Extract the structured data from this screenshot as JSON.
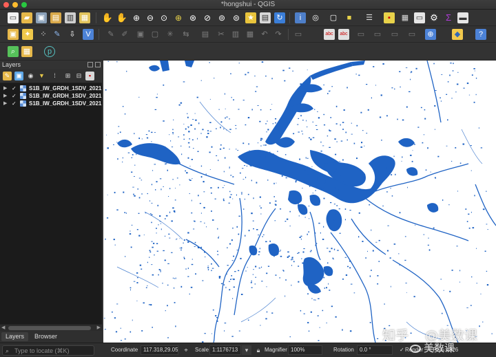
{
  "window": {
    "title": "*hongshui - QGIS"
  },
  "toolbars": {
    "row1": [
      "new-project-icon",
      "open-project-icon",
      "save-project-icon",
      "save-as-icon",
      "print-layout-icon",
      "layout-manager-icon",
      "pan-icon",
      "pan-to-selection-icon",
      "zoom-in-icon",
      "zoom-out-icon",
      "zoom-full-icon",
      "zoom-to-selection-icon",
      "zoom-to-layer-icon",
      "zoom-native-icon",
      "zoom-last-icon",
      "zoom-next-icon",
      "new-bookmark-icon",
      "show-bookmarks-icon",
      "refresh-icon",
      "identify-icon",
      "select-features-icon",
      "select-by-expression-icon",
      "deselect-icon",
      "open-attribute-table-icon",
      "statistics-icon",
      "measure-icon",
      "map-tips-icon",
      "toolbox-icon",
      "field-calculator-icon",
      "sum-icon",
      "ruler-icon"
    ],
    "row2": [
      "data-source-manager-icon",
      "new-layer-icon",
      "digitize-icon",
      "edits-icon",
      "toggle-editing-icon",
      "save-edits-icon",
      "add-polygon-icon",
      "vertex-tool-icon",
      "undo-icon",
      "redo-icon",
      "label-icon",
      "label-pin-icon",
      "label-show-icon",
      "label-move-icon",
      "label-rotate-icon",
      "label-change-icon",
      "plugins-icon",
      "python-icon",
      "help-icon"
    ],
    "row3": [
      "search-tool-icon",
      "georeferencer-icon",
      "plugin-circle-icon"
    ]
  },
  "layers_panel": {
    "title": "Layers",
    "layers": [
      {
        "name": "S1B_IW_GRDH_1SDV_2021",
        "checked": true
      },
      {
        "name": "S1B_IW_GRDH_1SDV_2021",
        "checked": true
      },
      {
        "name": "S1B_IW_GRDH_1SDV_2021",
        "checked": true
      }
    ],
    "tabs": {
      "layers": "Layers",
      "browser": "Browser"
    }
  },
  "statusbar": {
    "locator_placeholder": "Type to locate (⌘K)",
    "coordinate_label": "Coordinate",
    "coordinate_value": "117.318,29.058",
    "scale_label": "Scale",
    "scale_value": "1:1176713",
    "magnifier_label": "Magnifier",
    "magnifier_value": "100%",
    "rotation_label": "Rotation",
    "rotation_value": "0.0 °",
    "render_label": "Render",
    "crs_label": "EPSG:4326"
  },
  "watermark": {
    "site": "知乎",
    "author": "@美数课",
    "sub": "美数课"
  },
  "colors": {
    "water": "#1f63c4",
    "background": "#ffffff",
    "chrome": "#333333"
  }
}
